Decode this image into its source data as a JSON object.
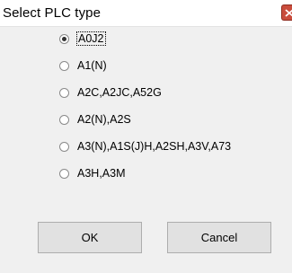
{
  "dialog": {
    "title": "Select PLC type",
    "close_label": "×"
  },
  "plc_types": {
    "selected": "A0J2",
    "options": [
      {
        "label": "A0J2",
        "checked": true
      },
      {
        "label": "A1(N)",
        "checked": false
      },
      {
        "label": "A2C,A2JC,A52G",
        "checked": false
      },
      {
        "label": "A2(N),A2S",
        "checked": false
      },
      {
        "label": "A3(N),A1S(J)H,A2SH,A3V,A73",
        "checked": false
      },
      {
        "label": "A3H,A3M",
        "checked": false
      }
    ]
  },
  "buttons": {
    "ok_label": "OK",
    "cancel_label": "Cancel"
  },
  "colors": {
    "close_button": "#c94c3c",
    "background": "#f0f0f0",
    "button_face": "#e1e1e1"
  }
}
